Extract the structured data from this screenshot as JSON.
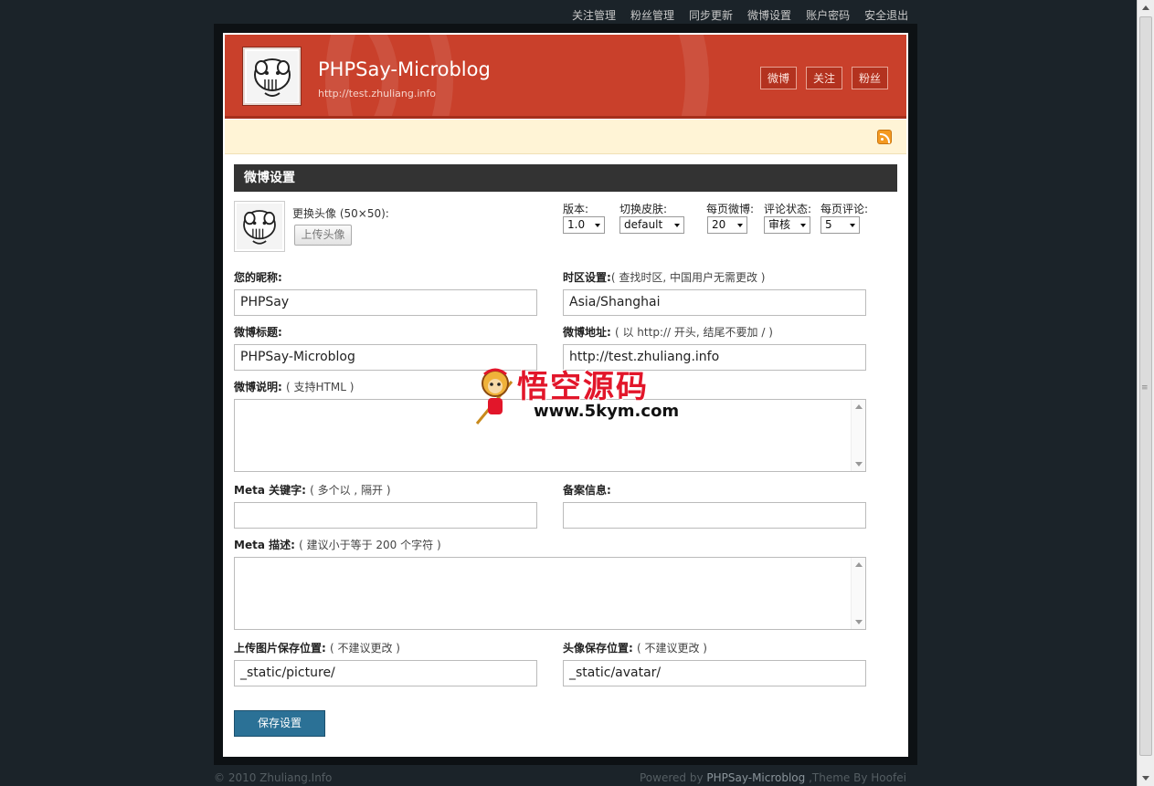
{
  "topnav": [
    "关注管理",
    "粉丝管理",
    "同步更新",
    "微博设置",
    "账户密码",
    "安全退出"
  ],
  "header": {
    "title": "PHPSay-Microblog",
    "subtitle": "http://test.zhuliang.info",
    "buttons": [
      "微博",
      "关注",
      "粉丝"
    ],
    "accent": "#c9402b"
  },
  "section_title": "微博设置",
  "avatar": {
    "label": "更换头像 (50×50):",
    "upload_label": "上传头像"
  },
  "selects": [
    {
      "label": "版本:",
      "value": "1.0"
    },
    {
      "label": "切换皮肤:",
      "value": "default"
    },
    {
      "label": "每页微博:",
      "value": "20"
    },
    {
      "label": "评论状态:",
      "value": "审核"
    },
    {
      "label": "每页评论:",
      "value": "5"
    }
  ],
  "fields": {
    "nickname": {
      "label": "您的昵称:",
      "value": "PHPSay"
    },
    "timezone": {
      "label": "时区设置:",
      "hint_open": "( ",
      "hint_link": "查找时区",
      "hint_rest": ", 中国用户无需更改 )",
      "value": "Asia/Shanghai"
    },
    "blog_title": {
      "label": "微博标题:",
      "value": "PHPSay-Microblog"
    },
    "blog_url": {
      "label": "微博地址:",
      "hint": "( 以 http:// 开头, 结尾不要加 / )",
      "value": "http://test.zhuliang.info"
    },
    "description": {
      "label": "微博说明:",
      "hint": "( 支持HTML )",
      "value": ""
    },
    "meta_keywords": {
      "label": "Meta 关键字:",
      "hint": "( 多个以 , 隔开 )",
      "value": ""
    },
    "icp": {
      "label": "备案信息:",
      "value": ""
    },
    "meta_description": {
      "label": "Meta 描述:",
      "hint": "( 建议小于等于 200 个字符 )",
      "value": ""
    },
    "picture_path": {
      "label": "上传图片保存位置:",
      "hint": "( 不建议更改 )",
      "value": "_static/picture/"
    },
    "avatar_path": {
      "label": "头像保存位置:",
      "hint": "( 不建议更改 )",
      "value": "_static/avatar/"
    }
  },
  "save_label": "保存设置",
  "watermark": {
    "text": "悟空源码",
    "url": "www.5kym.com"
  },
  "footer": {
    "copyright": "© 2010 Zhuliang.Info",
    "powered_prefix": "Powered by ",
    "powered_name": "PHPSay-Microblog",
    "powered_suffix": " ,Theme By Hoofei"
  }
}
